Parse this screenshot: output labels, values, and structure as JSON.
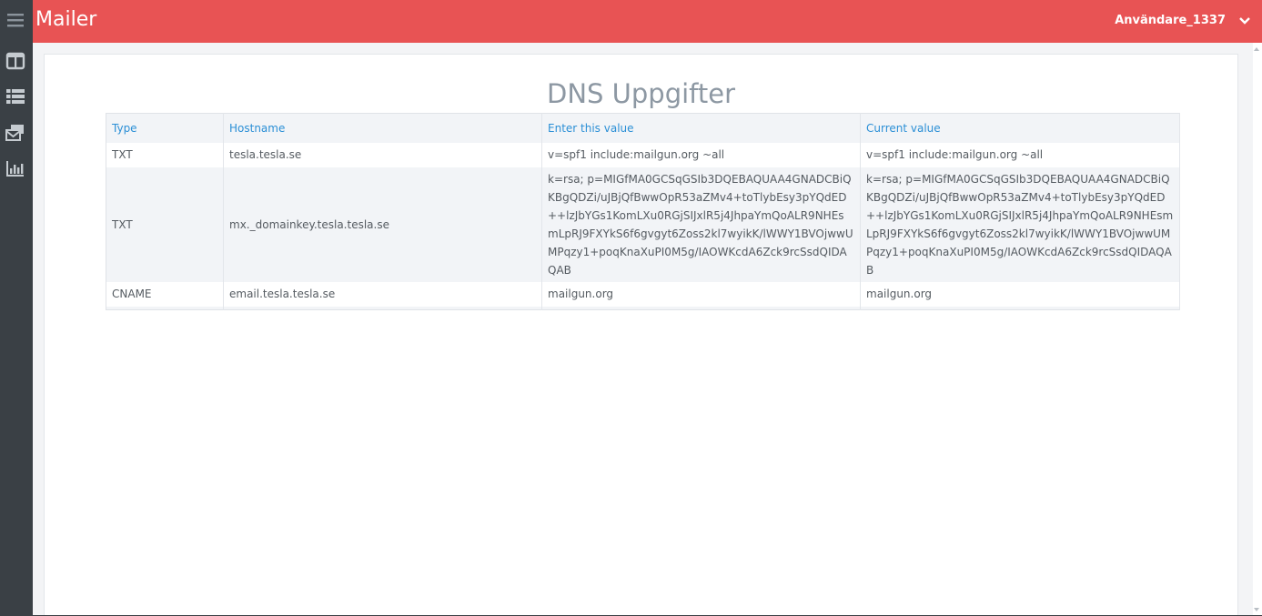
{
  "app": {
    "title": "Mailer"
  },
  "header": {
    "user_name": "Användare_1337"
  },
  "sidebar": {
    "items": [
      {
        "icon": "menu-icon"
      },
      {
        "icon": "columns-icon"
      },
      {
        "icon": "list-icon"
      },
      {
        "icon": "mail-stack-icon"
      },
      {
        "icon": "bar-chart-icon"
      }
    ]
  },
  "page": {
    "title": "DNS Uppgifter"
  },
  "table": {
    "headers": [
      "Type",
      "Hostname",
      "Enter this value",
      "Current value"
    ],
    "rows": [
      {
        "type": "TXT",
        "hostname": "tesla.tesla.se",
        "enter_value": "v=spf1 include:mailgun.org ~all",
        "current_value": "v=spf1 include:mailgun.org ~all"
      },
      {
        "type": "TXT",
        "hostname": "mx._domainkey.tesla.tesla.se",
        "enter_value": "k=rsa; p=MIGfMA0GCSqGSIb3DQEBAQUAA4GNADCBiQKBgQDZi/uJBjQfBwwOpR53aZMv4+toTlybEsy3pYQdED++lzJbYGs1KomLXu0RGjSIJxlR5j4JhpaYmQoALR9NHEsmLpRJ9FXYkS6f6gvgyt6Zoss2kl7wyikK/lWWY1BVOjwwUMPqzy1+poqKnaXuPI0M5g/IAOWKcdA6Zck9rcSsdQIDAQAB",
        "current_value": "k=rsa; p=MIGfMA0GCSqGSIb3DQEBAQUAA4GNADCBiQKBgQDZi/uJBjQfBwwOpR53aZMv4+toTlybEsy3pYQdED++lzJbYGs1KomLXu0RGjSIJxlR5j4JhpaYmQoALR9NHEsmLpRJ9FXYkS6f6gvgyt6Zoss2kl7wyikK/lWWY1BVOjwwUMPqzy1+poqKnaXuPI0M5g/IAOWKcdA6Zck9rcSsdQIDAQAB"
      },
      {
        "type": "CNAME",
        "hostname": "email.tesla.tesla.se",
        "enter_value": "mailgun.org",
        "current_value": "mailgun.org"
      }
    ]
  },
  "colors": {
    "topbar": "#e85354",
    "sidebar": "#3a4045",
    "header_text": "#2b8fd6",
    "title": "#8d98a3"
  }
}
